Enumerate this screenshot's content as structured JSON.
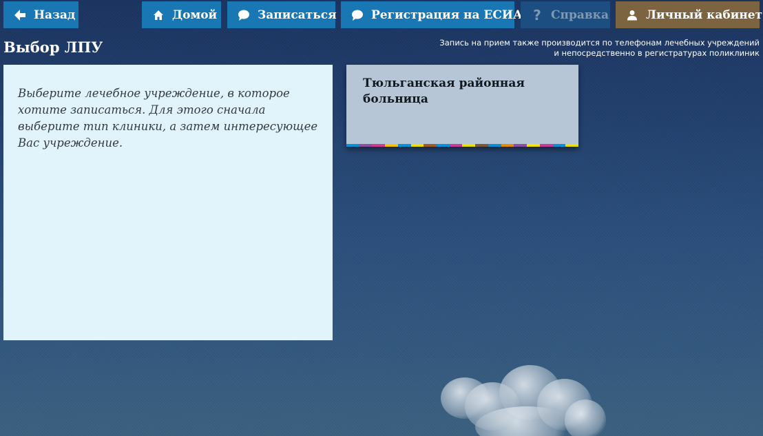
{
  "nav": {
    "back_label": "Назад",
    "home_label": "Домой",
    "signup_label": "Записаться",
    "esia_label": "Регистрация на ЕСИА",
    "help_label": "Справка",
    "cabinet_label": "Личный кабинет"
  },
  "icons": {
    "back": "arrow-left-icon",
    "home": "home-icon",
    "signup": "chat-bubble-icon",
    "esia": "chat-bubble-icon",
    "help": "question-mark-icon",
    "cabinet": "user-icon"
  },
  "header": {
    "title": "Выбор ЛПУ",
    "note_line1": "Запись на прием также производится по телефонам лечебных учреждений",
    "note_line2": "и непосредственно в регистратурах поликлиник"
  },
  "info": {
    "text": "Выберите лечебное учреждение, в которое хотите записаться. Для этого сначала выберите тип клиники, а затем интересующее Вас учреждение."
  },
  "clinics": [
    {
      "name": "Тюльганская районная больница"
    }
  ],
  "colors": {
    "nav_blue": "#1978b3",
    "nav_disabled": "#1c4e82",
    "nav_brown": "#7d6440",
    "info_panel": "#e2f4fb",
    "clinic_card": "#b7c6d6",
    "stripe": [
      "#0b8fd6",
      "#8e4fa0",
      "#d23a8e",
      "#f2c500",
      "#0b8fd6",
      "#e8e000",
      "#a05a2c",
      "#0b8fd6",
      "#c83c96",
      "#e8e000",
      "#7a5a3a",
      "#0b8fd6",
      "#e68a00",
      "#8e4fa0",
      "#f2e500",
      "#c83c96",
      "#0b8fd6",
      "#e8e000"
    ]
  }
}
